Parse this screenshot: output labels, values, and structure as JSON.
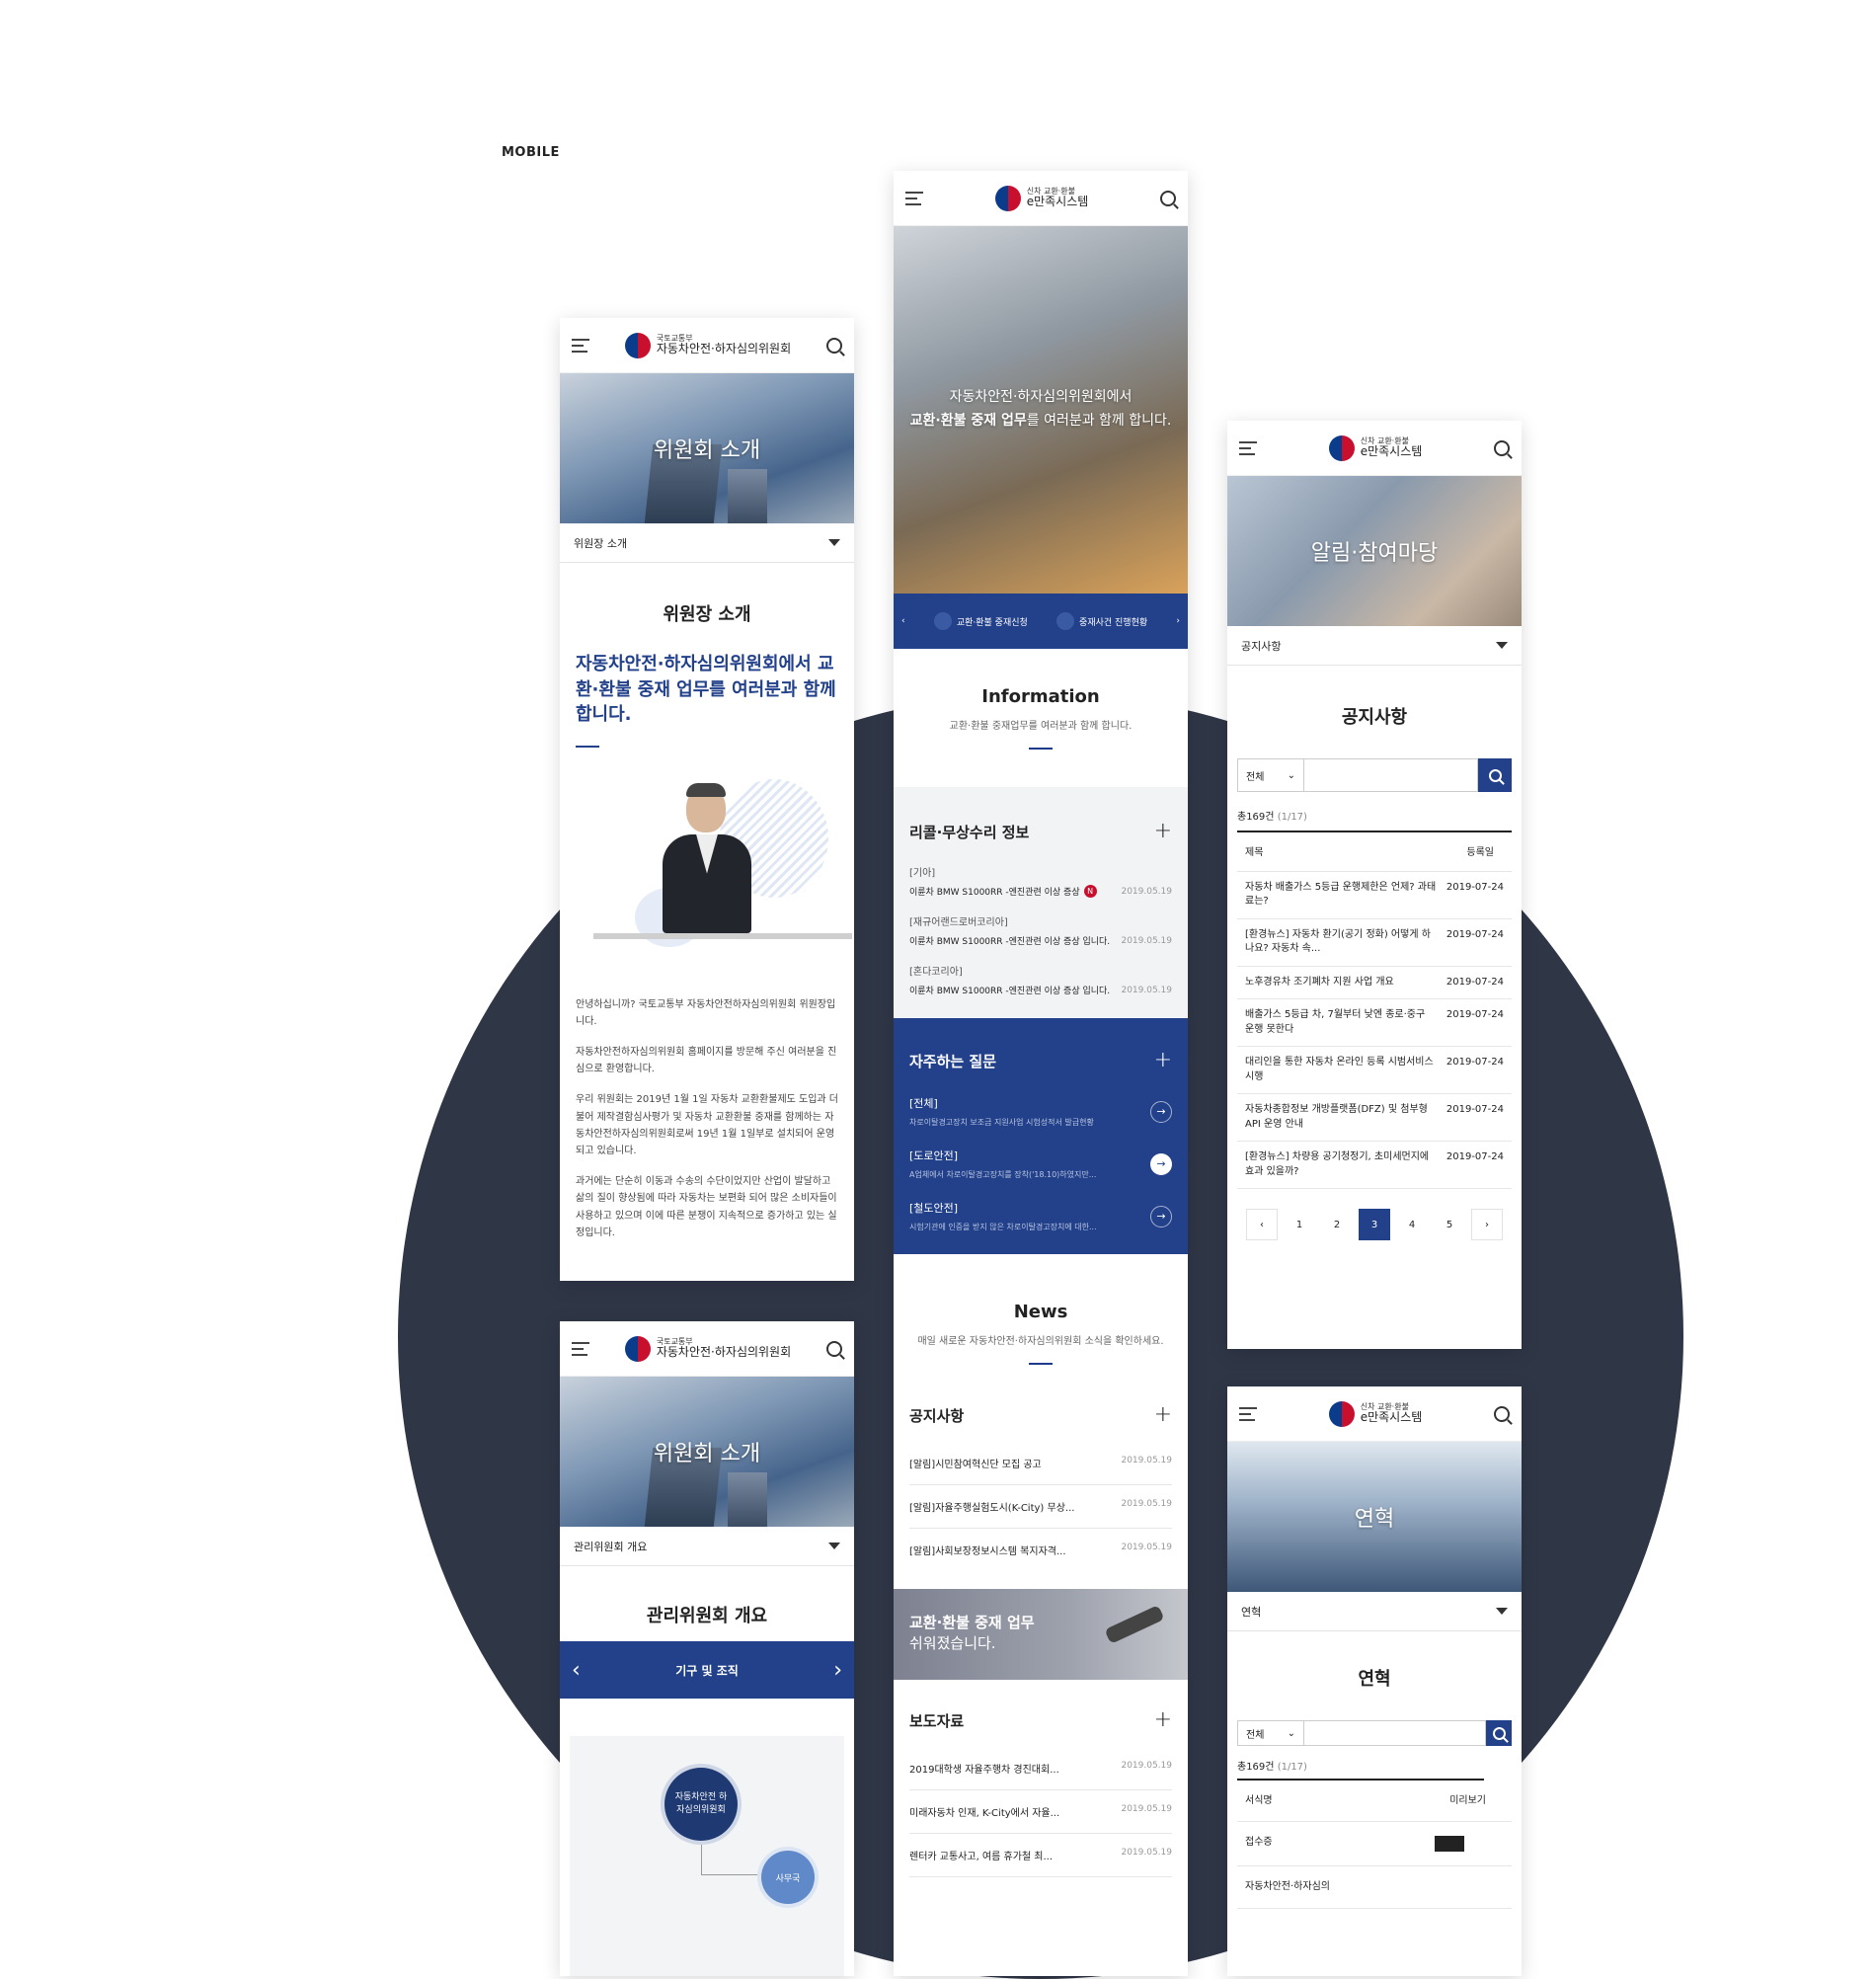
{
  "page_label": "MOBILE",
  "colors": {
    "navy": "#22418a",
    "circle_bg": "#2f3646"
  },
  "logo_committee": {
    "sub": "국토교통부",
    "main": "자동차안전·하자심의위원회"
  },
  "logo_emanjok": {
    "sub": "신차 교환·환불",
    "main": "e만족시스템"
  },
  "screen1": {
    "hero_title": "위원회 소개",
    "subnav_label": "위원장 소개",
    "section_title": "위원장 소개",
    "headline": "자동차안전·하자심의위원회에서 교환·환불 중재 업무를 여러분과 함께 합니다.",
    "paragraphs": [
      "안녕하십니까? 국토교통부 자동차안전하자심의위원회 위원장입니다.",
      "자동차안전하자심의위원회 홈페이지를 방문해 주신 여러분을 진심으로 환영합니다.",
      "우리 위원회는 2019년 1월 1일 자동차 교환환불제도 도입과 더불어 제작결함심사평가 및 자동차 교환환불 중재를 함께하는 자동차안전하자심의위원회로써 19년 1월 1일부로 설치되어 운영되고 있습니다.",
      "과거에는 단순히 이동과 수송의 수단이었지만 산업이 발달하고 삶의 질이 향상됨에 따라 자동차는 보편화 되어 많은 소비자들이 사용하고 있으며 이에 따른 분쟁이 지속적으로 증가하고 있는 실정입니다."
    ]
  },
  "screen2": {
    "hero_title": "위원회 소개",
    "subnav_label": "관리위원회 개요",
    "section_title": "관리위원회 개요",
    "tab_label": "기구 및 조직",
    "org_main": "자동차안전 하자심의위원회",
    "org_sub": "사무국"
  },
  "screen3": {
    "hero_line1": "자동차안전·하자심의위원회에서",
    "hero_line2_bold": "교환·환불 중재 업무",
    "hero_line2_rest": "를 여러분과 함께 합니다.",
    "quick_links": [
      "교환·환불 중재신청",
      "중재사건 진행현황"
    ],
    "info_title": "Information",
    "info_sub": "교환·환불 중재업무를 여러분과 함께 합니다.",
    "recall_title": "리콜·무상수리 정보",
    "recall_items": [
      {
        "maker": "[기아]",
        "text": "이륜차 BMW S1000RR -엔진관련 이상 증상",
        "badge": "N",
        "date": "2019.05.19"
      },
      {
        "maker": "[재규어랜드로버코리아]",
        "text": "이륜차 BMW S1000RR -엔진관련 이상 증상 입니다.",
        "badge": "",
        "date": "2019.05.19"
      },
      {
        "maker": "[혼다코리아]",
        "text": "이륜차 BMW S1000RR -엔진관련 이상 증상 입니다.",
        "badge": "",
        "date": "2019.05.19"
      }
    ],
    "faq_title": "자주하는 질문",
    "faq_items": [
      {
        "cat": "[전체]",
        "text": "차로이탈경고장치 보조금 지원사업 시험성적서 발급현황"
      },
      {
        "cat": "[도로안전]",
        "text": "A업체에서 차로이탈경고장치를 장착('18.10)하였지만..."
      },
      {
        "cat": "[철도안전]",
        "text": "시험기관에 인증을 받지 않은 차로이탈경고장치에 대한..."
      }
    ],
    "news_title": "News",
    "news_sub": "매일 새로운 자동차안전·하자심의위원회 소식을 확인하세요.",
    "notice_title": "공지사항",
    "notice_items": [
      {
        "text": "[알림]시민참여혁신단 모집 공고",
        "date": "2019.05.19"
      },
      {
        "text": "[알림]자율주행실험도시(K-City) 무상...",
        "date": "2019.05.19"
      },
      {
        "text": "[알림]사회보장정보시스템 복지자격...",
        "date": "2019.05.19"
      }
    ],
    "banner_line1": "교환·환불 중재 업무",
    "banner_line2": "쉬워졌습니다.",
    "press_title": "보도자료",
    "press_items": [
      {
        "text": "2019대학생 자율주행차 경진대회...",
        "date": "2019.05.19"
      },
      {
        "text": "미래자동차 인재, K-City에서 자율...",
        "date": "2019.05.19"
      },
      {
        "text": "렌터카 교통사고, 여름 휴가철 최...",
        "date": "2019.05.19"
      }
    ]
  },
  "screen4": {
    "hero_title": "알림·참여마당",
    "subnav_label": "공지사항",
    "section_title": "공지사항",
    "select_value": "전체",
    "count_text": "총169건",
    "count_page": "(1/17)",
    "col_title": "제목",
    "col_date": "등록일",
    "rows": [
      {
        "title": "자동차 배출가스 5등급 운행제한은 언제? 과태료는?",
        "date": "2019-07-24"
      },
      {
        "title": "[환경뉴스] 자동차 환기(공기 정화) 어떻게 하나요? 자동차 속...",
        "date": "2019-07-24"
      },
      {
        "title": "노후경유차 조기폐차 지원 사업 개요",
        "date": "2019-07-24"
      },
      {
        "title": "배출가스 5등급 차, 7월부터 낮엔 종로·중구 운행 못한다",
        "date": "2019-07-24"
      },
      {
        "title": "대리인을 통한 자동차 온라인 등록 시범서비스 시행",
        "date": "2019-07-24"
      },
      {
        "title": "자동차종합정보 개방플랫폼(DFZ) 및 첨부형API 운영 안내",
        "date": "2019-07-24"
      },
      {
        "title": "[환경뉴스] 차량용 공기청정기, 초미세먼지에 효과 있을까?",
        "date": "2019-07-24"
      }
    ],
    "pages": [
      "‹",
      "1",
      "2",
      "3",
      "4",
      "5",
      "›"
    ],
    "active_page": "3"
  },
  "screen5": {
    "hero_title": "연혁",
    "subnav_label": "연혁",
    "section_title": "연혁",
    "select_value": "전체",
    "count_text": "총169건",
    "count_page": "(1/17)",
    "col_name": "서식명",
    "col_preview": "미리보기",
    "rows": [
      "접수증",
      "자동차안전·하자심의"
    ]
  }
}
